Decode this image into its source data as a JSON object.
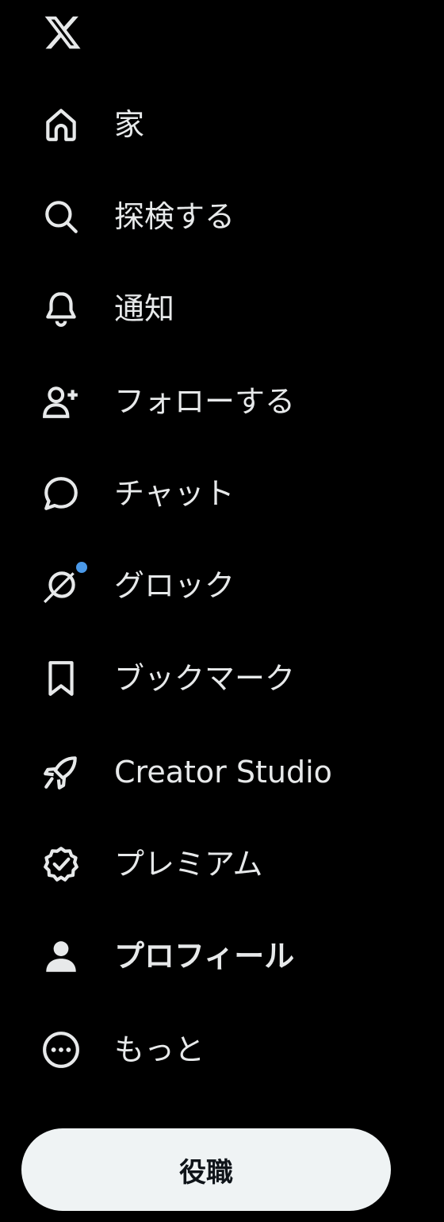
{
  "logo": {
    "icon": "x-logo-icon"
  },
  "nav": {
    "items": [
      {
        "id": "home",
        "label": "家",
        "icon": "home-icon"
      },
      {
        "id": "explore",
        "label": "探検する",
        "icon": "search-icon"
      },
      {
        "id": "notifications",
        "label": "通知",
        "icon": "bell-icon"
      },
      {
        "id": "follow",
        "label": "フォローする",
        "icon": "person-add-icon"
      },
      {
        "id": "chat",
        "label": "チャット",
        "icon": "chat-bubble-icon"
      },
      {
        "id": "grok",
        "label": "グロック",
        "icon": "grok-icon",
        "badge": true
      },
      {
        "id": "bookmarks",
        "label": "ブックマーク",
        "icon": "bookmark-icon"
      },
      {
        "id": "creator-studio",
        "label": "Creator Studio",
        "icon": "rocket-icon"
      },
      {
        "id": "premium",
        "label": "プレミアム",
        "icon": "verified-badge-icon"
      },
      {
        "id": "profile",
        "label": "プロフィール",
        "icon": "person-icon",
        "active": true
      },
      {
        "id": "more",
        "label": "もっと",
        "icon": "more-circle-icon"
      }
    ]
  },
  "post_button": {
    "label": "役職"
  },
  "colors": {
    "background": "#000000",
    "text": "#e7e9ea",
    "button_bg": "#eff3f4",
    "button_text": "#0f1419",
    "badge": "#4a99e9"
  }
}
